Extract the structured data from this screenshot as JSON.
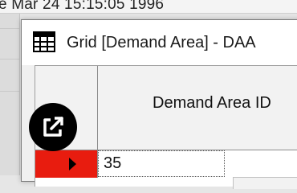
{
  "background": {
    "top_text": "e Mar 24 15:15:05 1996"
  },
  "window": {
    "title": "Grid [Demand Area] - DAA",
    "app_icon": "grid-table-icon"
  },
  "grid": {
    "column_header": "Demand Area ID",
    "rows": [
      {
        "value": "35",
        "selected": true
      }
    ],
    "row_indicator_color": "#e81c0f"
  },
  "overlay": {
    "icon": "external-link-icon"
  }
}
